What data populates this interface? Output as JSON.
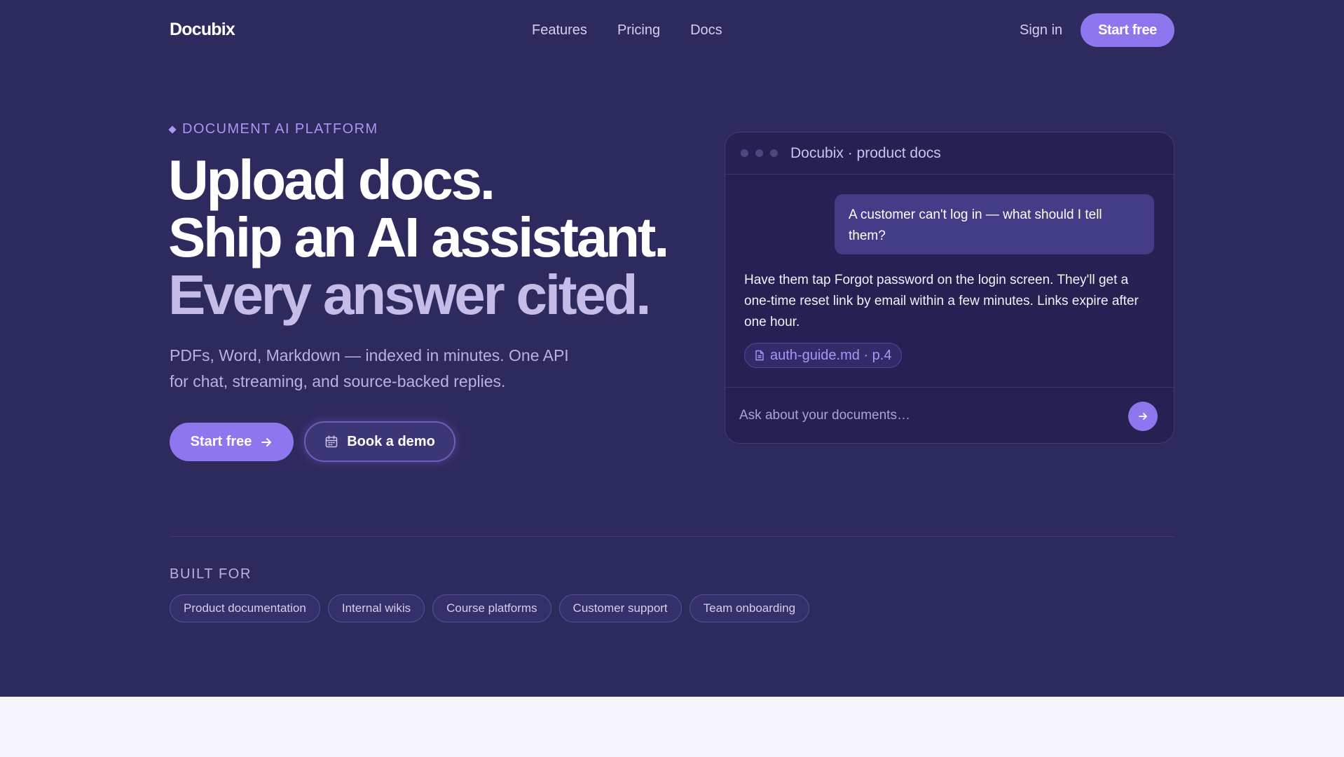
{
  "nav": {
    "logo": "Docubix",
    "links": [
      "Features",
      "Pricing",
      "Docs"
    ],
    "signin": "Sign in",
    "cta": "Start free"
  },
  "hero": {
    "eyebrow": "DOCUMENT AI PLATFORM",
    "headline": [
      "Upload docs.",
      "Ship an AI assistant.",
      "Every answer cited."
    ],
    "subtitle": "PDFs, Word, Markdown — indexed in minutes. One API for chat, streaming, and source-backed replies.",
    "primary_button": "Start free",
    "secondary_button": "Book a demo"
  },
  "chat": {
    "title": "Docubix · product docs",
    "user_message": "A customer can't log in — what should I tell them?",
    "bot_message": "Have them tap Forgot password on the login screen. They'll get a one-time reset link by email within a few minutes. Links expire after one hour.",
    "citation": "auth-guide.md · p.4",
    "input_placeholder": "Ask about your documents…"
  },
  "built_for": {
    "heading": "BUILT FOR",
    "tags": [
      "Product documentation",
      "Internal wikis",
      "Course platforms",
      "Customer support",
      "Team onboarding"
    ]
  },
  "colors": {
    "background": "#2d2a5e",
    "accent": "#8d76ee",
    "accent_text": "#a996f5",
    "chat_panel": "#252152",
    "bottom_band": "#f6f5fc"
  },
  "icons": {
    "primary_button": "arrow-right-icon",
    "secondary_button": "calendar-icon",
    "citation": "document-icon",
    "send": "arrow-right-icon"
  }
}
